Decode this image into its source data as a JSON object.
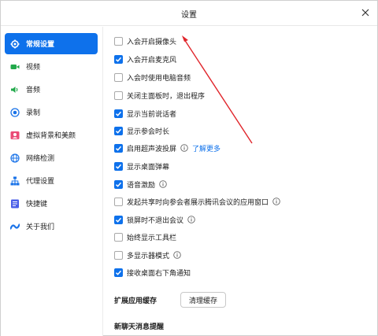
{
  "window": {
    "title": "设置"
  },
  "sidebar": {
    "items": [
      {
        "label": "常规设置",
        "icon": "gear-icon",
        "active": true
      },
      {
        "label": "视频",
        "icon": "video-icon",
        "active": false
      },
      {
        "label": "音频",
        "icon": "audio-icon",
        "active": false
      },
      {
        "label": "录制",
        "icon": "record-icon",
        "active": false
      },
      {
        "label": "虚拟背景和美颜",
        "icon": "virtual-background-icon",
        "active": false
      },
      {
        "label": "网络检测",
        "icon": "network-icon",
        "active": false
      },
      {
        "label": "代理设置",
        "icon": "proxy-icon",
        "active": false
      },
      {
        "label": "快捷键",
        "icon": "keyboard-icon",
        "active": false
      },
      {
        "label": "关于我们",
        "icon": "about-icon",
        "active": false
      }
    ]
  },
  "options": [
    {
      "label": "入会开启摄像头",
      "checked": false
    },
    {
      "label": "入会开启麦克风",
      "checked": true
    },
    {
      "label": "入会时使用电脑音频",
      "checked": false
    },
    {
      "label": "关闭主面板时，退出程序",
      "checked": false
    },
    {
      "label": "显示当前说话者",
      "checked": true
    },
    {
      "label": "显示参会时长",
      "checked": true
    },
    {
      "label": "启用超声波投屏",
      "checked": true,
      "info": true,
      "link": "了解更多"
    },
    {
      "label": "显示桌面弹幕",
      "checked": true
    },
    {
      "label": "语音激励",
      "checked": true,
      "info": true
    },
    {
      "label": "发起共享时向参会者展示腾讯会议的应用窗口",
      "checked": false,
      "info": true
    },
    {
      "label": "锁屏时不退出会议",
      "checked": true,
      "info": true
    },
    {
      "label": "始终显示工具栏",
      "checked": false
    },
    {
      "label": "多显示器模式",
      "checked": false,
      "info": true
    },
    {
      "label": "接收桌面右下角通知",
      "checked": true
    }
  ],
  "cache": {
    "section_label": "扩展应用缓存",
    "button_label": "清理缓存"
  },
  "chat": {
    "section_label": "新聊天消息提醒"
  },
  "colors": {
    "accent": "#0e71eb",
    "annotation": "#e0252b"
  }
}
